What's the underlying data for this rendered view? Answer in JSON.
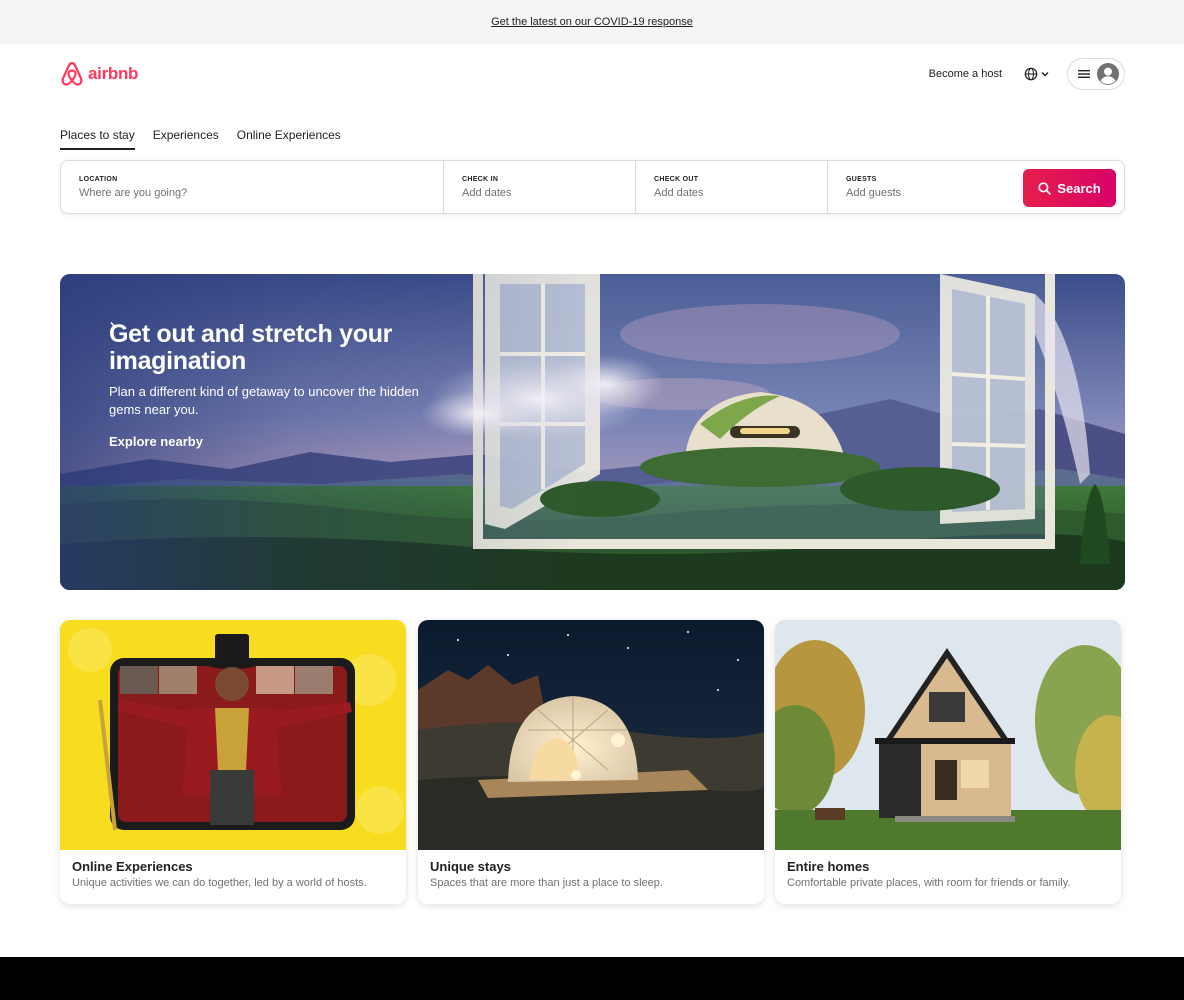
{
  "banner": {
    "text": "Get the latest on our COVID-19 response"
  },
  "brand": {
    "name": "airbnb",
    "color": "#ff385c"
  },
  "nav": {
    "host_label": "Become a host",
    "lang_icon": "globe-icon",
    "menu_icon": "hamburger-icon",
    "avatar_icon": "user-avatar-icon"
  },
  "tabs": [
    {
      "label": "Places to stay",
      "active": true
    },
    {
      "label": "Experiences",
      "active": false
    },
    {
      "label": "Online Experiences",
      "active": false
    }
  ],
  "search": {
    "location": {
      "label": "LOCATION",
      "placeholder": "Where are you going?"
    },
    "checkin": {
      "label": "CHECK IN",
      "placeholder": "Add dates"
    },
    "checkout": {
      "label": "CHECK OUT",
      "placeholder": "Add dates"
    },
    "guests": {
      "label": "GUESTS",
      "placeholder": "Add guests"
    },
    "button_label": "Search",
    "button_color": "#e61e4d"
  },
  "hero": {
    "title": "Get out and stretch your imagination",
    "subtitle": "Plan a different kind of getaway to uncover the hidden gems near you.",
    "link": "Explore nearby"
  },
  "cards": [
    {
      "title": "Online Experiences",
      "desc": "Unique activities we can do together, led by a world of hosts."
    },
    {
      "title": "Unique stays",
      "desc": "Spaces that are more than just a place to sleep."
    },
    {
      "title": "Entire homes",
      "desc": "Comfortable private places, with room for friends or family."
    }
  ]
}
